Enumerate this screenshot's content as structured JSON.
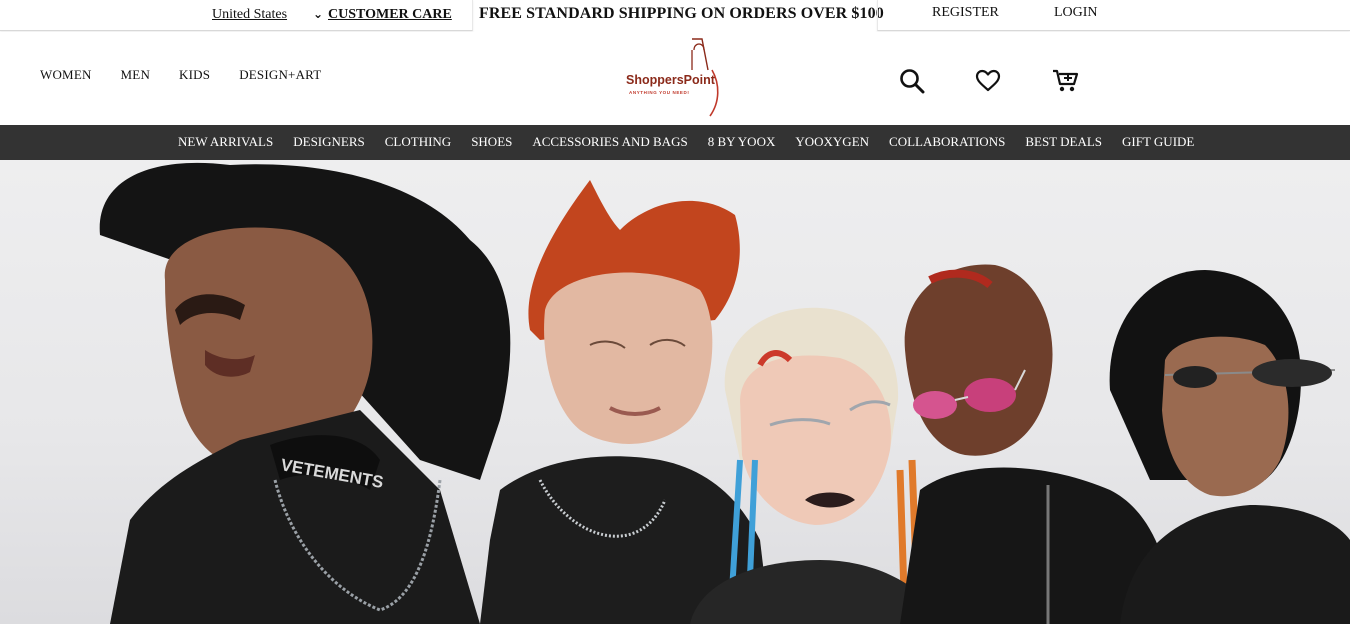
{
  "topbar": {
    "country": "United States",
    "customer_care": "CUSTOMER CARE",
    "promo": "FREE STANDARD SHIPPING ON ORDERS OVER $100",
    "register": "REGISTER",
    "login": "LOGIN"
  },
  "header": {
    "gender_nav": [
      "WOMEN",
      "MEN",
      "KIDS",
      "DESIGN+ART"
    ],
    "logo": {
      "name": "ShoppersPoint",
      "tagline": "ANYTHING YOU NEED!",
      "color": "#8b2a1a"
    },
    "icons": [
      "search-icon",
      "heart-icon",
      "cart-icon"
    ]
  },
  "categories": [
    "NEW ARRIVALS",
    "DESIGNERS",
    "CLOTHING",
    "SHOES",
    "ACCESSORIES AND BAGS",
    "8 BY YOOX",
    "YOOXYGEN",
    "COLLABORATIONS",
    "BEST DEALS",
    "GIFT GUIDE"
  ],
  "hero": {
    "image": "fashion-campaign-photo",
    "shirt_text": "VETEMENTS"
  },
  "colors": {
    "category_bar": "#333333",
    "accent": "#8b2a1a"
  }
}
